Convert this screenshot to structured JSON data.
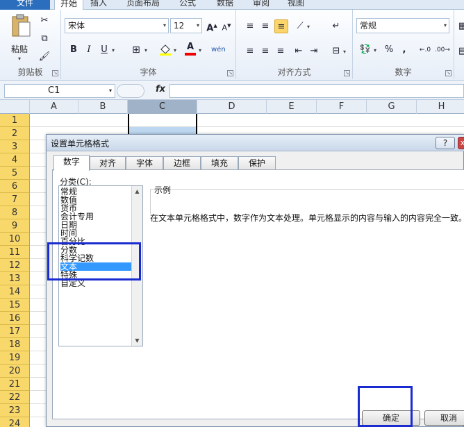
{
  "ribbon": {
    "tabs": [
      "文件",
      "开始",
      "插入",
      "页面布局",
      "公式",
      "数据",
      "审阅",
      "视图"
    ],
    "clipboard": {
      "paste_label": "粘贴",
      "group_label": "剪贴板"
    },
    "font": {
      "name": "宋体",
      "size": "12",
      "group_label": "字体",
      "bold": "B",
      "italic": "I",
      "underline": "U"
    },
    "alignment": {
      "group_label": "对齐方式"
    },
    "number": {
      "format": "常规",
      "group_label": "数字"
    }
  },
  "formula_bar": {
    "name_box": "C1",
    "fx": "fx"
  },
  "sheet": {
    "columns": [
      "A",
      "B",
      "C",
      "D",
      "E",
      "F",
      "G",
      "H"
    ],
    "rows": [
      "1",
      "2",
      "3",
      "4",
      "5",
      "6",
      "7",
      "8",
      "9",
      "10",
      "11",
      "12",
      "13",
      "14",
      "15",
      "16",
      "17",
      "18",
      "19",
      "20",
      "21",
      "22",
      "23",
      "24"
    ]
  },
  "dialog": {
    "title": "设置单元格格式",
    "help": "?",
    "close": "x",
    "tabs": [
      "数字",
      "对齐",
      "字体",
      "边框",
      "填充",
      "保护"
    ],
    "category_label": "分类(C):",
    "categories": [
      "常规",
      "数值",
      "货币",
      "会计专用",
      "日期",
      "时间",
      "百分比",
      "分数",
      "科学记数",
      "文本",
      "特殊",
      "自定义"
    ],
    "selected_category": "文本",
    "sample_label": "示例",
    "description": "在文本单元格格式中，数字作为文本处理。单元格显示的内容与输入的内容完全一致。",
    "ok": "确定",
    "cancel": "取消"
  },
  "colors": {
    "highlight": "#1a2ccf",
    "selected_item": "#3399ff",
    "row_header": "#f9d86b"
  }
}
